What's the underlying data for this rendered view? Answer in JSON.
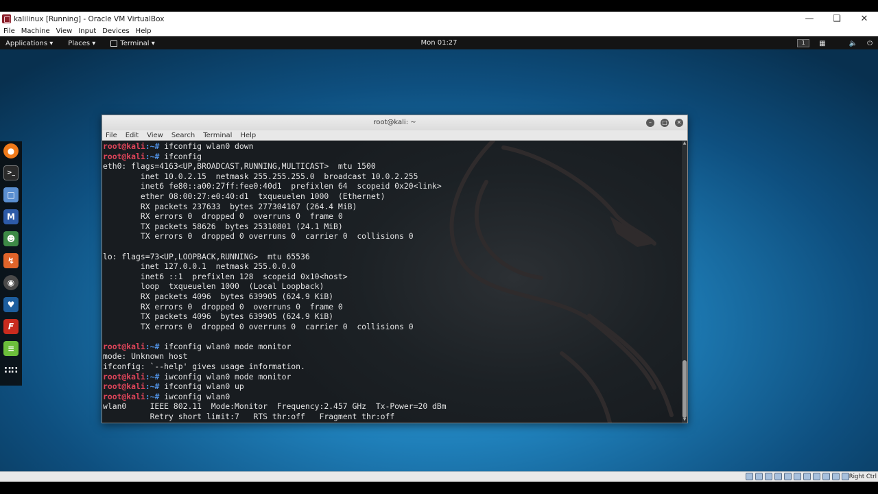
{
  "vbox": {
    "title": "kalilinux [Running] - Oracle VM VirtualBox",
    "menu": [
      "File",
      "Machine",
      "View",
      "Input",
      "Devices",
      "Help"
    ],
    "host_key": "Right Ctrl"
  },
  "gnome": {
    "applications": "Applications ▾",
    "places": "Places ▾",
    "terminal": "Terminal ▾",
    "clock": "Mon 01:27",
    "workspace": "1"
  },
  "dock_icons": [
    {
      "name": "firefox-icon",
      "color": "#f07a1a"
    },
    {
      "name": "terminal-icon",
      "color": "#2b2b2b"
    },
    {
      "name": "files-icon",
      "color": "#5a8fd1"
    },
    {
      "name": "metasploit-icon",
      "color": "#2d5ba8"
    },
    {
      "name": "armitage-icon",
      "color": "#3d8a46"
    },
    {
      "name": "burpsuite-icon",
      "color": "#e0642a"
    },
    {
      "name": "maltego-icon",
      "color": "#4a4a4a"
    },
    {
      "name": "beef-icon",
      "color": "#1d5e9e"
    },
    {
      "name": "faraday-icon",
      "color": "#c92b1e"
    },
    {
      "name": "leafpad-icon",
      "color": "#6cbf3b"
    },
    {
      "name": "show-apps-icon",
      "color": "#333333"
    }
  ],
  "terminal": {
    "title": "root@kali: ~",
    "menu": [
      "File",
      "Edit",
      "View",
      "Search",
      "Terminal",
      "Help"
    ],
    "lines": [
      {
        "user": "root@kali",
        "path": ":~# ",
        "text": "ifconfig wlan0 down"
      },
      {
        "user": "root@kali",
        "path": ":~# ",
        "text": "ifconfig"
      },
      {
        "text": "eth0: flags=4163<UP,BROADCAST,RUNNING,MULTICAST>  mtu 1500"
      },
      {
        "text": "        inet 10.0.2.15  netmask 255.255.255.0  broadcast 10.0.2.255"
      },
      {
        "text": "        inet6 fe80::a00:27ff:fee0:40d1  prefixlen 64  scopeid 0x20<link>"
      },
      {
        "text": "        ether 08:00:27:e0:40:d1  txqueuelen 1000  (Ethernet)"
      },
      {
        "text": "        RX packets 237633  bytes 277304167 (264.4 MiB)"
      },
      {
        "text": "        RX errors 0  dropped 0  overruns 0  frame 0"
      },
      {
        "text": "        TX packets 58626  bytes 25310801 (24.1 MiB)"
      },
      {
        "text": "        TX errors 0  dropped 0 overruns 0  carrier 0  collisions 0"
      },
      {
        "text": ""
      },
      {
        "text": "lo: flags=73<UP,LOOPBACK,RUNNING>  mtu 65536"
      },
      {
        "text": "        inet 127.0.0.1  netmask 255.0.0.0"
      },
      {
        "text": "        inet6 ::1  prefixlen 128  scopeid 0x10<host>"
      },
      {
        "text": "        loop  txqueuelen 1000  (Local Loopback)"
      },
      {
        "text": "        RX packets 4096  bytes 639905 (624.9 KiB)"
      },
      {
        "text": "        RX errors 0  dropped 0  overruns 0  frame 0"
      },
      {
        "text": "        TX packets 4096  bytes 639905 (624.9 KiB)"
      },
      {
        "text": "        TX errors 0  dropped 0 overruns 0  carrier 0  collisions 0"
      },
      {
        "text": ""
      },
      {
        "user": "root@kali",
        "path": ":~# ",
        "text": "ifconfig wlan0 mode monitor"
      },
      {
        "text": "mode: Unknown host"
      },
      {
        "text": "ifconfig: `--help' gives usage information."
      },
      {
        "user": "root@kali",
        "path": ":~# ",
        "text": "iwconfig wlan0 mode monitor"
      },
      {
        "user": "root@kali",
        "path": ":~# ",
        "text": "ifconfig wlan0 up"
      },
      {
        "user": "root@kali",
        "path": ":~# ",
        "text": "iwconfig wlan0"
      },
      {
        "text": "wlan0     IEEE 802.11  Mode:Monitor  Frequency:2.457 GHz  Tx-Power=20 dBm"
      },
      {
        "text": "          Retry short limit:7   RTS thr:off   Fragment thr:off"
      }
    ]
  }
}
